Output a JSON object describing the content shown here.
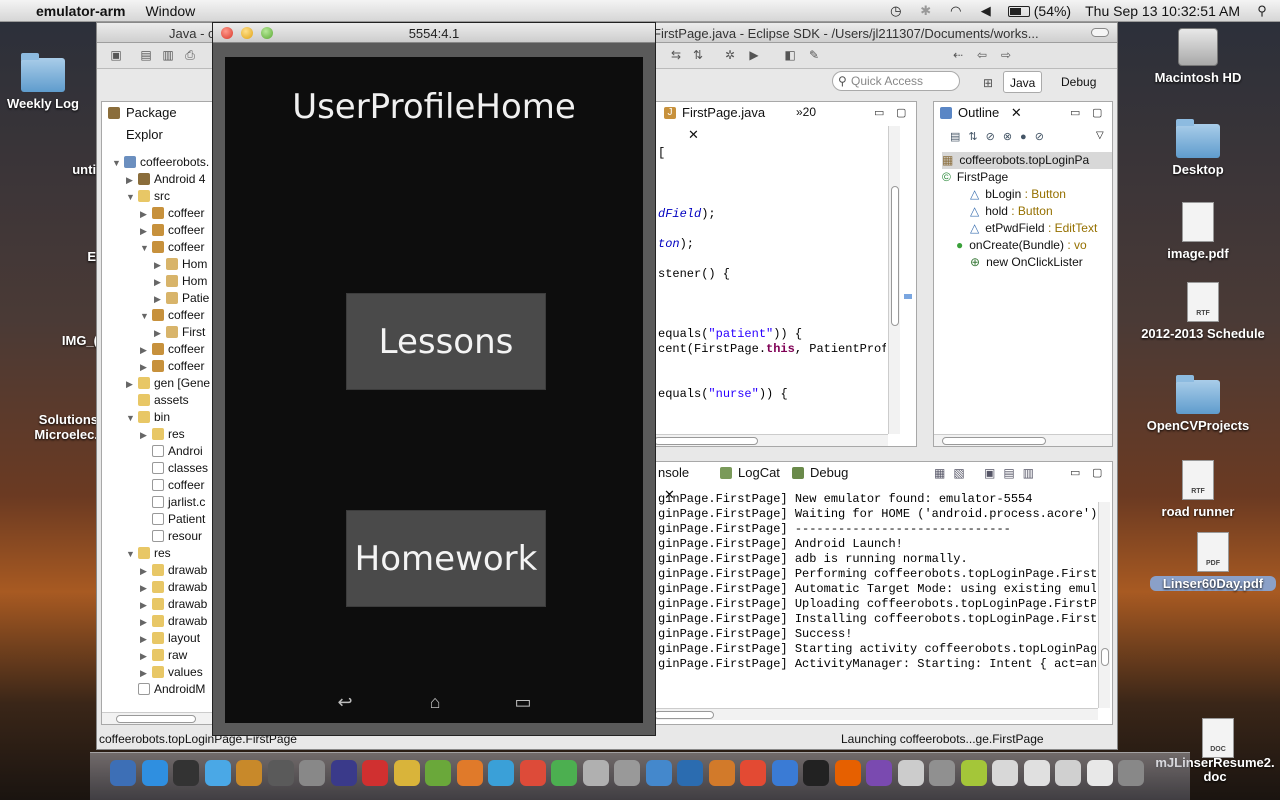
{
  "menubar": {
    "app_name": "emulator-arm",
    "menus": [
      "Window"
    ],
    "battery": "(54%)",
    "datetime": "Thu Sep 13  10:32:51 AM"
  },
  "desktop": {
    "icons_left": [
      "Weekly Log",
      "untitl",
      "E",
      "IMG_(",
      "Solutions",
      "Microelec."
    ],
    "icons_right": [
      "Macintosh HD",
      "Desktop",
      "image.pdf",
      "2012-2013 Schedule",
      "OpenCVProjects",
      "road runner",
      "Linser60Day.pdf",
      "mJLinserResume2.\ndoc"
    ],
    "doc_badges": [
      "RTF",
      "RTF",
      "PDF",
      "DOC"
    ]
  },
  "eclipse": {
    "title_left": "Java - c",
    "title": "FirstPage.java - Eclipse SDK - /Users/jl211307/Documents/works...",
    "quick_access_placeholder": "Quick Access",
    "perspectives": [
      "Java",
      "Debug"
    ],
    "package_explorer": {
      "tab": "Package Explor",
      "rows": [
        {
          "label": "coffeerobots.",
          "icon": "proj",
          "twist": "▼",
          "indent": 0
        },
        {
          "label": "Android 4",
          "icon": "lib",
          "twist": "▶",
          "indent": 1
        },
        {
          "label": "src",
          "icon": "fold",
          "twist": "▼",
          "indent": 1
        },
        {
          "label": "coffeer",
          "icon": "pkg",
          "twist": "▶",
          "indent": 2
        },
        {
          "label": "coffeer",
          "icon": "pkg",
          "twist": "▶",
          "indent": 2
        },
        {
          "label": "coffeer",
          "icon": "pkg",
          "twist": "▼",
          "indent": 2
        },
        {
          "label": "Hom",
          "icon": "jfile",
          "twist": "▶",
          "indent": 3
        },
        {
          "label": "Hom",
          "icon": "jfile",
          "twist": "▶",
          "indent": 3
        },
        {
          "label": "Patie",
          "icon": "jfile",
          "twist": "▶",
          "indent": 3
        },
        {
          "label": "coffeer",
          "icon": "pkg",
          "twist": "▼",
          "indent": 2
        },
        {
          "label": "First",
          "icon": "jfile",
          "twist": "▶",
          "indent": 3
        },
        {
          "label": "coffeer",
          "icon": "pkg",
          "twist": "▶",
          "indent": 2
        },
        {
          "label": "coffeer",
          "icon": "pkg",
          "twist": "▶",
          "indent": 2
        },
        {
          "label": "gen [Gene",
          "icon": "fold",
          "twist": "▶",
          "indent": 1
        },
        {
          "label": "assets",
          "icon": "fold",
          "twist": "",
          "indent": 1
        },
        {
          "label": "bin",
          "icon": "fold",
          "twist": "▼",
          "indent": 1
        },
        {
          "label": "res",
          "icon": "fold",
          "twist": "▶",
          "indent": 2
        },
        {
          "label": "Androi",
          "icon": "file",
          "twist": "",
          "indent": 2
        },
        {
          "label": "classes",
          "icon": "file",
          "twist": "",
          "indent": 2
        },
        {
          "label": "coffeer",
          "icon": "file",
          "twist": "",
          "indent": 2
        },
        {
          "label": "jarlist.c",
          "icon": "file",
          "twist": "",
          "indent": 2
        },
        {
          "label": "Patient",
          "icon": "file",
          "twist": "",
          "indent": 2
        },
        {
          "label": "resour",
          "icon": "file",
          "twist": "",
          "indent": 2
        },
        {
          "label": "res",
          "icon": "fold",
          "twist": "▼",
          "indent": 1
        },
        {
          "label": "drawab",
          "icon": "fold",
          "twist": "▶",
          "indent": 2
        },
        {
          "label": "drawab",
          "icon": "fold",
          "twist": "▶",
          "indent": 2
        },
        {
          "label": "drawab",
          "icon": "fold",
          "twist": "▶",
          "indent": 2
        },
        {
          "label": "drawab",
          "icon": "fold",
          "twist": "▶",
          "indent": 2
        },
        {
          "label": "layout",
          "icon": "fold",
          "twist": "▶",
          "indent": 2
        },
        {
          "label": "raw",
          "icon": "fold",
          "twist": "▶",
          "indent": 2
        },
        {
          "label": "values",
          "icon": "fold",
          "twist": "▶",
          "indent": 2
        },
        {
          "label": "AndroidM",
          "icon": "file",
          "twist": "",
          "indent": 1
        }
      ]
    },
    "editor": {
      "tab": "FirstPage.java",
      "overflow": "»20",
      "lines": [
        {
          "pre": "[",
          "it": "",
          "post": ""
        },
        {
          "pre": "",
          "it": "dField",
          "post": ");"
        },
        {
          "pre": "",
          "it": "ton",
          "post": ");"
        },
        {
          "pre": "stener() {",
          "it": "",
          "post": ""
        },
        {
          "pre": "equals(",
          "str": "\"patient\"",
          "post": ")) {"
        },
        {
          "pre": "cent(FirstPage.",
          "kw": "this",
          "post": ", PatientProfil"
        },
        {
          "pre": "equals(",
          "str": "\"nurse\"",
          "post": ")) {"
        }
      ]
    },
    "outline": {
      "tab": "Outline",
      "rows": [
        {
          "name": "coffeerobots.topLoginPa",
          "type": "",
          "level": 0
        },
        {
          "name": "FirstPage",
          "type": "",
          "level": 0
        },
        {
          "name": "bLogin",
          "type": " : Button",
          "level": 2
        },
        {
          "name": "hold",
          "type": " : Button",
          "level": 2
        },
        {
          "name": "etPwdField",
          "type": " : EditText",
          "level": 2
        },
        {
          "name": "onCreate(Bundle)",
          "type": " : vo",
          "level": 1
        },
        {
          "name": "new OnClickLister",
          "type": "",
          "level": 2
        }
      ]
    },
    "console": {
      "tabs": [
        "nsole",
        "LogCat",
        "Debug"
      ],
      "lines": [
        "ginPage.FirstPage] New emulator found: emulator-5554",
        "ginPage.FirstPage] Waiting for HOME ('android.process.acore') t",
        "ginPage.FirstPage] ------------------------------",
        "ginPage.FirstPage] Android Launch!",
        "ginPage.FirstPage] adb is running normally.",
        "ginPage.FirstPage] Performing coffeerobots.topLoginPage.FirstPa",
        "ginPage.FirstPage] Automatic Target Mode: using existing emulat",
        "ginPage.FirstPage] Uploading coffeerobots.topLoginPage.FirstPag",
        "ginPage.FirstPage] Installing coffeerobots.topLoginPage.FirstPa",
        "ginPage.FirstPage] Success!",
        "ginPage.FirstPage] Starting activity coffeerobots.topLoginPage.",
        "ginPage.FirstPage] ActivityManager: Starting: Intent { act=andr"
      ]
    },
    "status_left": "coffeerobots.topLoginPage.FirstPage",
    "status_right": "Launching coffeerobots...ge.FirstPage"
  },
  "emulator": {
    "title": "5554:4.1",
    "app_title": "UserProfileHome",
    "buttons": [
      "Lessons",
      "Homework"
    ]
  },
  "colors": {
    "dock_icons": [
      "#3d6fb6",
      "#2f8fe0",
      "#333333",
      "#4aa8e6",
      "#c8892a",
      "#5a5a5a",
      "#888888",
      "#3a3a8a",
      "#d03030",
      "#d9b43a",
      "#6aa83a",
      "#e07a2a",
      "#3aa0d8",
      "#dd4b39",
      "#4caf50",
      "#b0b0b0",
      "#999999",
      "#4488cc",
      "#2b6cb0",
      "#d27a2a",
      "#e34a33",
      "#3a7bd5",
      "#222222",
      "#e66000",
      "#7a4ab0",
      "#cccccc",
      "#909090",
      "#a4c639",
      "#d8d8d8",
      "#e0e0e0",
      "#d0d0d0",
      "#e8e8e8",
      "#888888"
    ]
  }
}
